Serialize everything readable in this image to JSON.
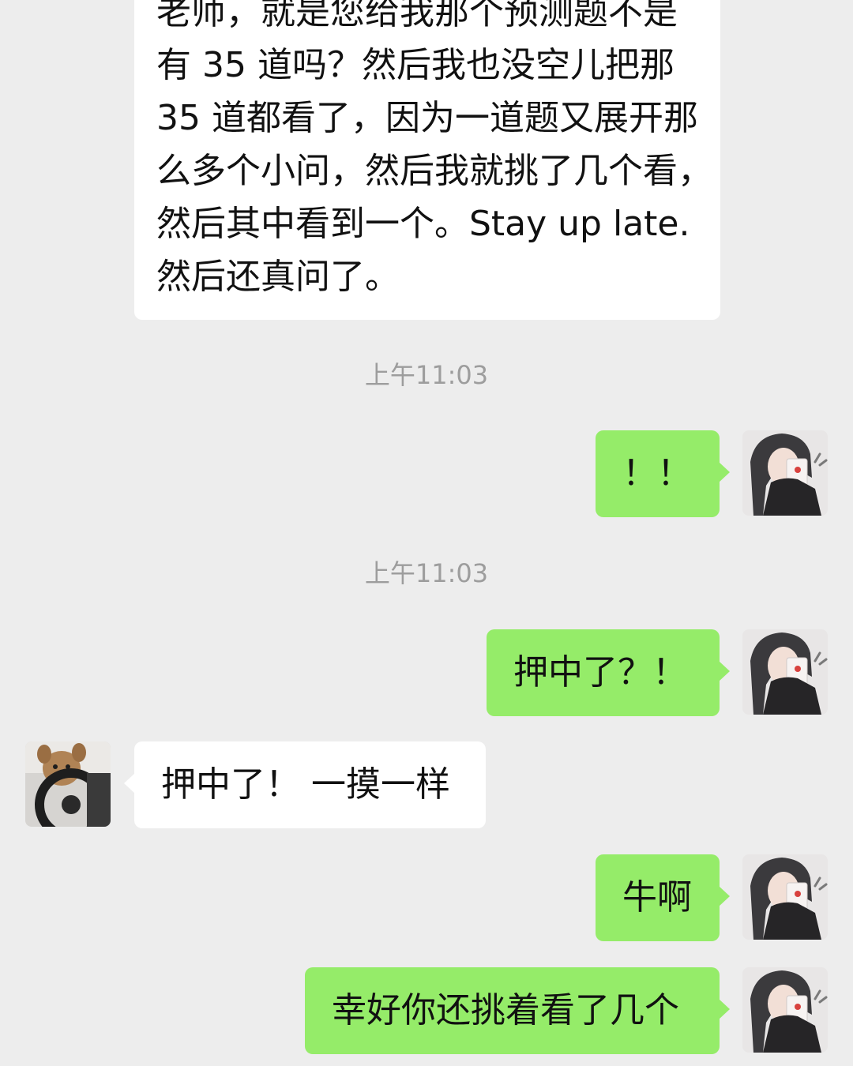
{
  "messages": [
    {
      "sender": "other",
      "lines": [
        "老师，就是您给我那个预测题不是",
        "有 35 道吗？然后我也没空儿把那",
        "35 道都看了，因为一道题又展开那",
        "么多个小问，然后我就挑了几个看，",
        "然后其中看到一个。Stay up late.",
        "然后还真问了。"
      ]
    },
    {
      "type": "time",
      "text": "上午11:03"
    },
    {
      "sender": "me",
      "text": "！！"
    },
    {
      "type": "time",
      "text": "上午11:03"
    },
    {
      "sender": "me",
      "text": "押中了？！"
    },
    {
      "sender": "other",
      "text": "押中了！ 一摸一样"
    },
    {
      "sender": "me",
      "text": "牛啊"
    },
    {
      "sender": "me",
      "text": "幸好你还挑着看了几个"
    }
  ],
  "avatars": {
    "me": "girl-covering-face-avatar",
    "other": "dog-driving-avatar"
  },
  "colors": {
    "background": "#ededed",
    "outgoing_bubble": "#95ec69",
    "incoming_bubble": "#ffffff",
    "timestamp": "#9d9d9d"
  }
}
